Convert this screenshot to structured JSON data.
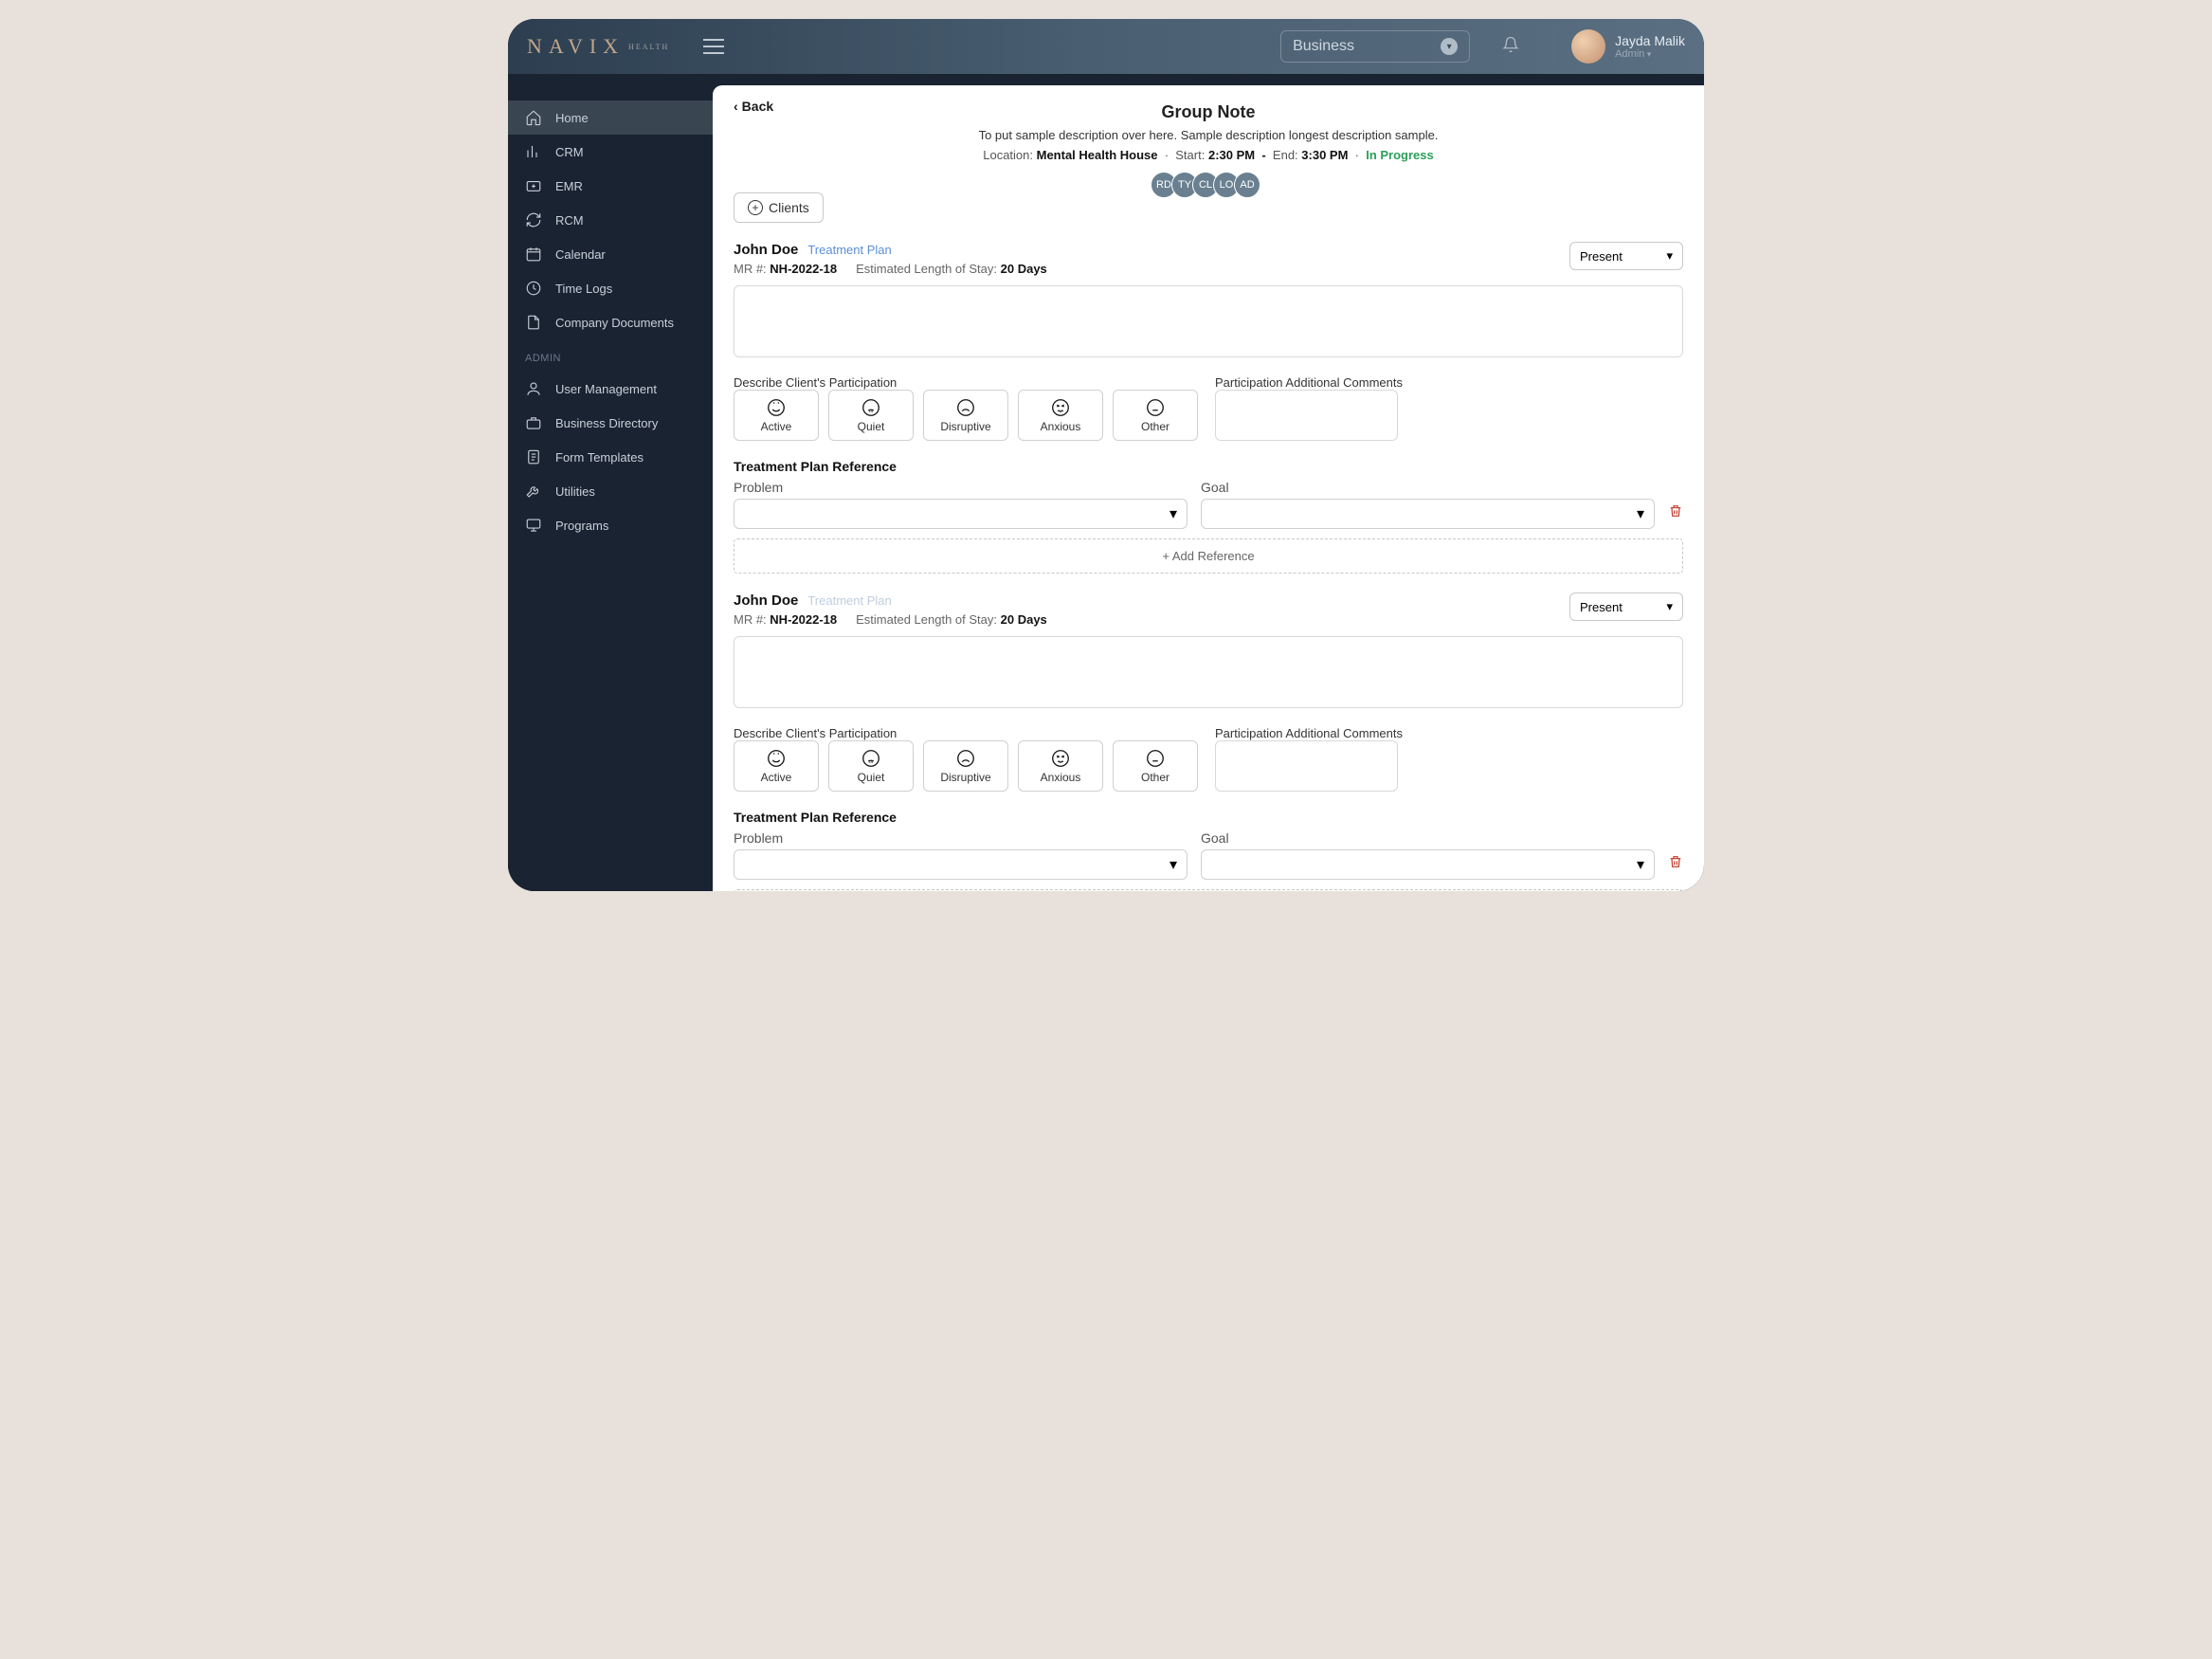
{
  "topbar": {
    "logo_main": "NAVIX",
    "logo_sub": "HEALTH",
    "business_selector": "Business",
    "user_name": "Jayda Malik",
    "user_role": "Admin"
  },
  "sidebar": {
    "items": [
      "Home",
      "CRM",
      "EMR",
      "RCM",
      "Calendar",
      "Time Logs",
      "Company Documents"
    ],
    "admin_label": "ADMIN",
    "admin_items": [
      "User Management",
      "Business Directory",
      "Form Templates",
      "Utilities",
      "Programs"
    ]
  },
  "page": {
    "back": "Back",
    "title": "Group Note",
    "description": "To put sample description over here. Sample description longest description sample.",
    "location_label": "Location:",
    "location_value": "Mental Health House",
    "start_label": "Start:",
    "start_value": "2:30 PM",
    "dash": "-",
    "end_label": "End:",
    "end_value": "3:30 PM",
    "status": "In Progress",
    "avatars": [
      "RD",
      "TY",
      "CL",
      "LO",
      "AD"
    ],
    "clients_button": "Clients"
  },
  "labels": {
    "treatment_plan": "Treatment Plan",
    "mr_label": "MR #:",
    "los_label": "Estimated Length of Stay:",
    "present": "Present",
    "participation_label": "Describe Client's Participation",
    "participation_comments_label": "Participation Additional Comments",
    "tref_header": "Treatment Plan Reference",
    "problem_label": "Problem",
    "goal_label": "Goal",
    "add_ref": "+ Add Reference",
    "opt_active": "Active",
    "opt_quiet": "Quiet",
    "opt_disruptive": "Disruptive",
    "opt_anxious": "Anxious",
    "opt_other": "Other"
  },
  "clients": [
    {
      "name": "John Doe",
      "mr": "NH-2022-18",
      "los": "20 Days",
      "tp_disabled": false
    },
    {
      "name": "John Doe",
      "mr": "NH-2022-18",
      "los": "20 Days",
      "tp_disabled": true
    }
  ]
}
